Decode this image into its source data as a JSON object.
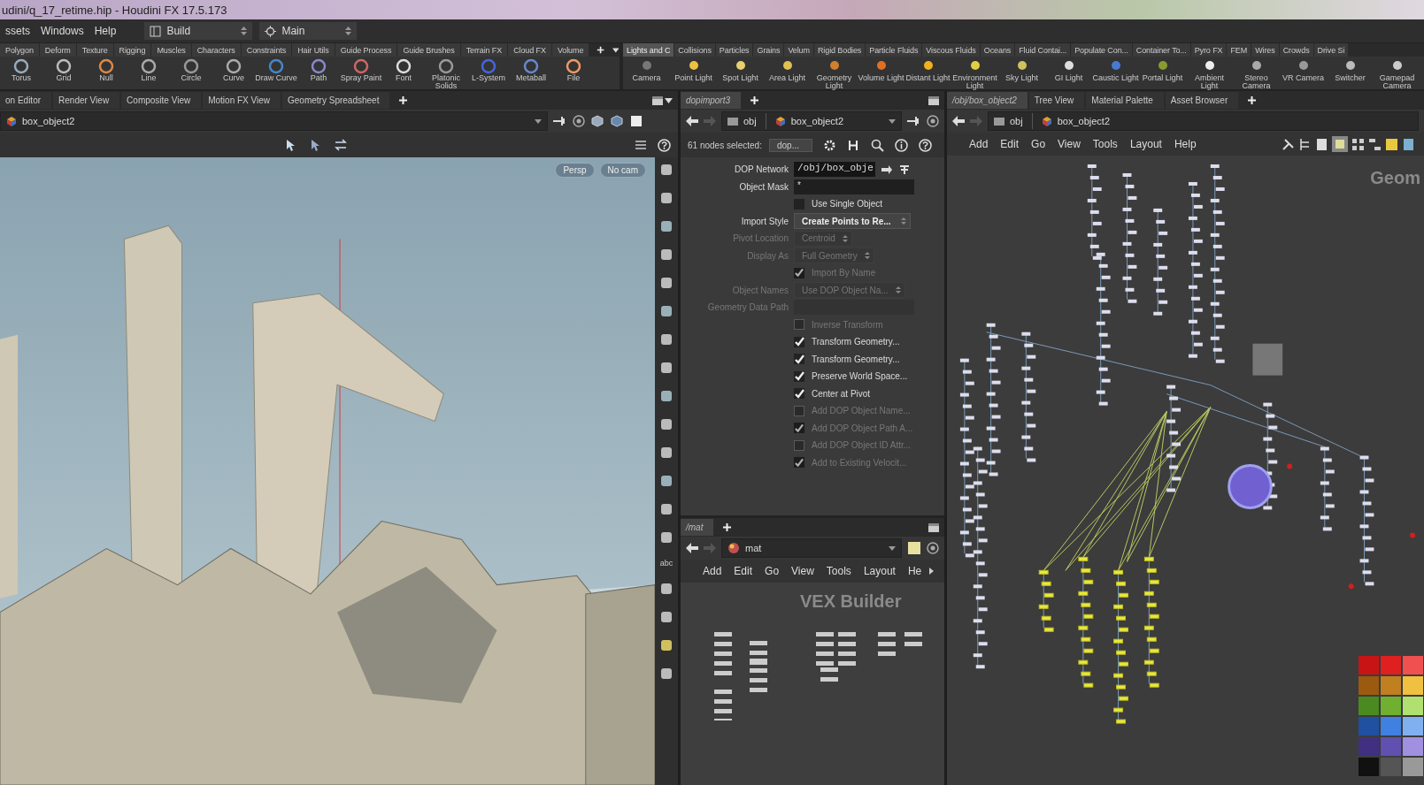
{
  "window": {
    "title": "udini/q_17_retime.hip - Houdini FX 17.5.173"
  },
  "menu": [
    "ssets",
    "Windows",
    "Help"
  ],
  "desktop": {
    "label": "Build"
  },
  "pane_layout": {
    "label": "Main"
  },
  "shelf_left": {
    "tabs": [
      {
        "label": "Polygon",
        "selected": false
      },
      {
        "label": "Deform",
        "selected": false
      },
      {
        "label": "Texture",
        "selected": false
      },
      {
        "label": "Rigging",
        "selected": false
      },
      {
        "label": "Muscles",
        "selected": false
      },
      {
        "label": "Characters",
        "selected": false
      },
      {
        "label": "Constraints",
        "selected": false
      },
      {
        "label": "Hair Utils",
        "selected": false
      },
      {
        "label": "Guide Process",
        "selected": false
      },
      {
        "label": "Guide Brushes",
        "selected": false
      },
      {
        "label": "Terrain FX",
        "selected": false
      },
      {
        "label": "Cloud FX",
        "selected": false
      },
      {
        "label": "Volume",
        "selected": false
      }
    ],
    "tools": [
      {
        "label": "Torus"
      },
      {
        "label": "Grid"
      },
      {
        "label": "Null"
      },
      {
        "label": "Line"
      },
      {
        "label": "Circle"
      },
      {
        "label": "Curve"
      },
      {
        "label": "Draw Curve"
      },
      {
        "label": "Path"
      },
      {
        "label": "Spray Paint"
      },
      {
        "label": "Font"
      },
      {
        "label": "Platonic Solids"
      },
      {
        "label": "L-System"
      },
      {
        "label": "Metaball"
      },
      {
        "label": "File"
      }
    ]
  },
  "shelf_right": {
    "tabs": [
      {
        "label": "Lights and C",
        "selected": true
      },
      {
        "label": "Collisions",
        "selected": false
      },
      {
        "label": "Particles",
        "selected": false
      },
      {
        "label": "Grains",
        "selected": false
      },
      {
        "label": "Velum",
        "selected": false
      },
      {
        "label": "Rigid Bodies",
        "selected": false
      },
      {
        "label": "Particle Fluids",
        "selected": false
      },
      {
        "label": "Viscous Fluids",
        "selected": false
      },
      {
        "label": "Oceans",
        "selected": false
      },
      {
        "label": "Fluid Contai...",
        "selected": false
      },
      {
        "label": "Populate Con...",
        "selected": false
      },
      {
        "label": "Container To...",
        "selected": false
      },
      {
        "label": "Pyro FX",
        "selected": false
      },
      {
        "label": "FEM",
        "selected": false
      },
      {
        "label": "Wires",
        "selected": false
      },
      {
        "label": "Crowds",
        "selected": false
      },
      {
        "label": "Drive Si",
        "selected": false
      }
    ],
    "tools": [
      {
        "label": "Camera"
      },
      {
        "label": "Point Light"
      },
      {
        "label": "Spot Light"
      },
      {
        "label": "Area Light"
      },
      {
        "label": "Geometry Light"
      },
      {
        "label": "Volume Light"
      },
      {
        "label": "Distant Light"
      },
      {
        "label": "Environment Light"
      },
      {
        "label": "Sky Light"
      },
      {
        "label": "GI Light"
      },
      {
        "label": "Caustic Light"
      },
      {
        "label": "Portal Light"
      },
      {
        "label": "Ambient Light"
      },
      {
        "label": "Stereo Camera"
      },
      {
        "label": "VR Camera"
      },
      {
        "label": "Switcher"
      },
      {
        "label": "Gamepad Camera"
      }
    ]
  },
  "viewport": {
    "tabs": [
      {
        "label": "on Editor",
        "selected": false
      },
      {
        "label": "Render View",
        "selected": false
      },
      {
        "label": "Composite View",
        "selected": false
      },
      {
        "label": "Motion FX View",
        "selected": false
      },
      {
        "label": "Geometry Spreadsheet",
        "selected": false
      }
    ],
    "path": "box_object2",
    "camera_menus": [
      "Persp",
      "No cam"
    ],
    "toolbar_label": "abc"
  },
  "parameters": {
    "tabs": [
      {
        "label": "dopimport3",
        "selected": true
      }
    ],
    "path": [
      "obj",
      "box_object2"
    ],
    "selection": "61 nodes selected:",
    "node_type": "dop...",
    "fields": [
      {
        "kind": "text",
        "label": "DOP Network",
        "value": "/obj/box_obje",
        "disabled": false
      },
      {
        "kind": "text",
        "label": "Object Mask",
        "value": "*",
        "disabled": false
      },
      {
        "kind": "checkbox",
        "label": "Use Single Object",
        "checked": false,
        "disabled": false
      },
      {
        "kind": "menu",
        "label": "Import Style",
        "value": "Create Points to Re...",
        "disabled": false
      },
      {
        "kind": "menu",
        "label": "Pivot Location",
        "value": "Centroid",
        "disabled": true
      },
      {
        "kind": "menu",
        "label": "Display As",
        "value": "Full Geometry",
        "disabled": true
      },
      {
        "kind": "checkbox",
        "label": "Import By Name",
        "checked": true,
        "disabled": true
      },
      {
        "kind": "menu",
        "label": "Object Names",
        "value": "Use DOP Object Na...",
        "disabled": true
      },
      {
        "kind": "text",
        "label": "Geometry Data Path",
        "disabled": true
      },
      {
        "kind": "checkbox",
        "label": "Inverse Transform",
        "checked": false,
        "disabled": true
      },
      {
        "kind": "checkbox",
        "label": "Transform Geometry...",
        "checked": true,
        "disabled": false
      },
      {
        "kind": "checkbox",
        "label": "Transform Geometry...",
        "checked": true,
        "disabled": false
      },
      {
        "kind": "checkbox",
        "label": "Preserve World Space...",
        "checked": true,
        "disabled": false
      },
      {
        "kind": "checkbox",
        "label": "Center at Pivot",
        "checked": true,
        "disabled": false
      },
      {
        "kind": "checkbox",
        "label": "Add DOP Object Name...",
        "checked": false,
        "disabled": true
      },
      {
        "kind": "checkbox",
        "label": "Add DOP Object Path A...",
        "checked": true,
        "disabled": true
      },
      {
        "kind": "checkbox",
        "label": "Add DOP Object ID Attr...",
        "checked": false,
        "disabled": true
      },
      {
        "kind": "checkbox",
        "label": "Add to Existing Velocit...",
        "checked": true,
        "disabled": true
      }
    ]
  },
  "mat_pane": {
    "tabs": [
      {
        "label": "/mat",
        "selected": true
      }
    ],
    "path": "mat",
    "menu": [
      "Add",
      "Edit",
      "Go",
      "View",
      "Tools",
      "Layout",
      "He"
    ],
    "context": "VEX Builder"
  },
  "network": {
    "tabs": [
      {
        "label": "/obj/box_object2",
        "selected": true
      },
      {
        "label": "Tree View",
        "selected": false
      },
      {
        "label": "Material Palette",
        "selected": false
      },
      {
        "label": "Asset Browser",
        "selected": false
      }
    ],
    "path": [
      "obj",
      "box_object2"
    ],
    "menu": [
      "Add",
      "Edit",
      "Go",
      "View",
      "Tools",
      "Layout",
      "Help"
    ],
    "context": "Geom"
  }
}
